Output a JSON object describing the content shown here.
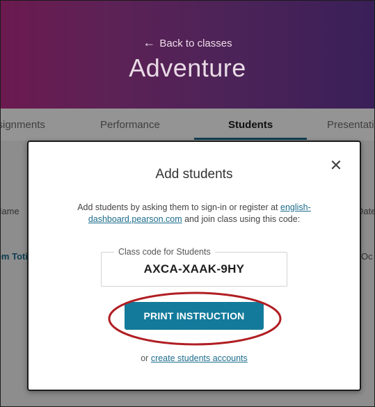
{
  "header": {
    "back_link": "Back to classes",
    "class_title": "Adventure"
  },
  "tabs": [
    {
      "label": "Assignments",
      "active": false
    },
    {
      "label": "Performance",
      "active": false
    },
    {
      "label": "Students",
      "active": true
    },
    {
      "label": "Presentation",
      "active": false
    }
  ],
  "background_table": {
    "headers": [
      "Name",
      "Date"
    ],
    "first_row": [
      "Tom Toti",
      "Oc"
    ]
  },
  "modal": {
    "title": "Add students",
    "description_before": "Add students by asking them to sign-in or register at",
    "link_text": "english-dashboard.pearson.com",
    "description_after": "and join class using this code:",
    "code_label": "Class code for Students",
    "code_value": "AXCA-XAAK-9HY",
    "print_button": "PRINT INSTRUCTION",
    "or_text": "or",
    "create_link": "create students accounts"
  },
  "colors": {
    "header_gradient_start": "#6b1a4f",
    "header_gradient_end": "#3a1f58",
    "accent": "#137a9b",
    "highlight_ring": "#b01e23"
  },
  "icons": {
    "back": "arrow-left-icon",
    "close": "close-icon"
  }
}
